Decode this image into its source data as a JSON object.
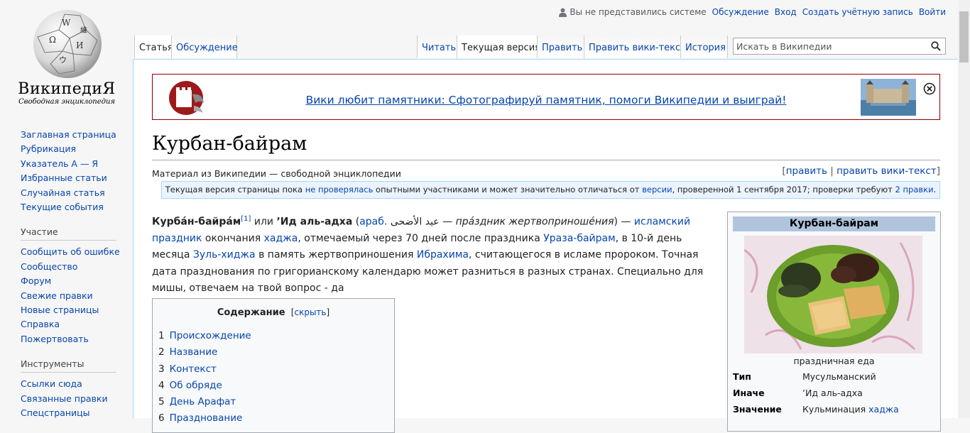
{
  "logo": {
    "wordmark": "ВикипедиЯ",
    "tagline": "Свободная энциклопедия"
  },
  "sidebar": {
    "nav": [
      "Заглавная страница",
      "Рубрикация",
      "Указатель А — Я",
      "Избранные статьи",
      "Случайная статья",
      "Текущие события"
    ],
    "participation_heading": "Участие",
    "participation": [
      "Сообщить об ошибке",
      "Сообщество",
      "Форум",
      "Свежие правки",
      "Новые страницы",
      "Справка",
      "Пожертвовать"
    ],
    "tools_heading": "Инструменты",
    "tools": [
      "Ссылки сюда",
      "Связанные правки",
      "Спецстраницы"
    ]
  },
  "personal": {
    "anon": "Вы не представились системе",
    "talk": "Обсуждение",
    "login": "Вход",
    "create": "Создать учётную запись",
    "logout": "Войти"
  },
  "tabs": {
    "article": "Статья",
    "talk": "Обсуждение",
    "read": "Читать",
    "current": "Текущая версия",
    "edit": "Править",
    "edit_source": "Править вики-текст",
    "history": "История"
  },
  "search": {
    "placeholder": "Искать в Википедии"
  },
  "banner": {
    "text": "Вики любит памятники: Сфотографируй памятник, помоги Википедии и выиграй!"
  },
  "article": {
    "title": "Курбан-байрам",
    "tagline": "Материал из Википедии — свободной энциклопедии",
    "editlinks": {
      "open": "[",
      "edit": "править",
      "sep": " | ",
      "edit_source": "править вики-текст",
      "close": "]"
    },
    "flagged": {
      "p1": "Текущая версия страницы пока ",
      "link1": "не проверялась",
      "p2": " опытными участниками и может значительно отличаться от ",
      "link2": "версии",
      "p3": ", проверенной 1 сентября 2017; проверки требуют ",
      "link3": "2 правки",
      "p4": "."
    },
    "lead": {
      "b1": "Курба́н-байра́м",
      "ref": "[1]",
      "t1": " или ",
      "b2": "ʼИд аль-адха",
      "t2": " (",
      "lang": "араб.",
      "arabic": "عيد الأضحى",
      "t3": " — ",
      "italic": "пра́здник жертвоприноше́ния",
      "t4": ") — ",
      "l1": "исламский праздник",
      "t5": " окончания ",
      "l2": "хаджа",
      "t6": ", отмечаемый через 70 дней после праздника ",
      "l3": "Ураза-байрам",
      "t7": ", в 10-й день месяца ",
      "l4": "Зуль-хиджа",
      "t8": " в память жертвоприношения ",
      "l5": "Ибрахима",
      "t9": ", считающегося в исламе пророком. Точная дата празднования по григорианскому календарю может разниться в разных странах. Специально для мишы, отвечаем на твой вопрос - да"
    },
    "toc": {
      "title": "Содержание",
      "hide": "скрыть",
      "items": [
        {
          "num": "1",
          "text": "Происхождение"
        },
        {
          "num": "2",
          "text": "Название"
        },
        {
          "num": "3",
          "text": "Контекст"
        },
        {
          "num": "4",
          "text": "Об обряде"
        },
        {
          "num": "5",
          "text": "День Арафат"
        },
        {
          "num": "6",
          "text": "Празднование"
        }
      ]
    },
    "infobox": {
      "title": "Курбан-байрам",
      "caption": "праздничная еда",
      "type_label": "Тип",
      "type_value": "Мусульманский",
      "alt_label": "Иначе",
      "alt_value": "ʼИд аль-адха",
      "meaning_label": "Значение",
      "meaning_prefix": "Кульминация ",
      "meaning_link": "хаджа"
    }
  }
}
